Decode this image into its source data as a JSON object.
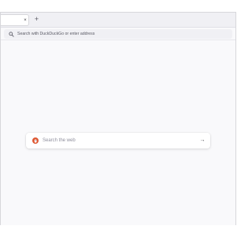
{
  "tabbar": {
    "close_glyph": "×",
    "new_tab_glyph": "+"
  },
  "urlbar": {
    "placeholder": "Search with DuckDuckGo or enter address",
    "icon": "search-icon"
  },
  "newtab": {
    "search_placeholder": "Search the web",
    "engine_icon": "duckduckgo-icon",
    "engine_color": "#de5833",
    "go_glyph": "→"
  }
}
